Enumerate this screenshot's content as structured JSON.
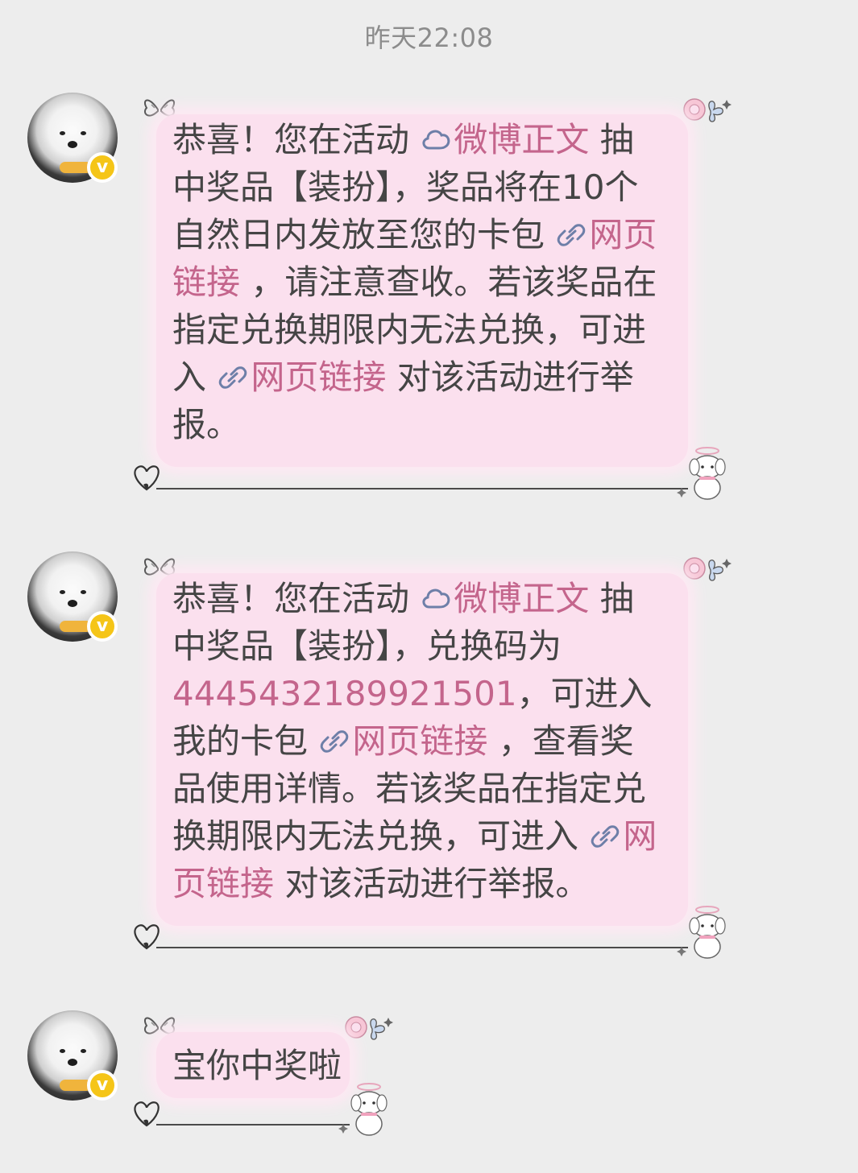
{
  "timestamp": "昨天22:08",
  "messages": [
    {
      "lines": [
        [
          {
            "t": "恭喜！您在活动 "
          },
          {
            "icon": "cloud"
          },
          {
            "t": "微博正文",
            "link": true
          },
          {
            "t": " 抽"
          }
        ],
        [
          {
            "t": "中奖品【装扮】，奖品将在10个"
          }
        ],
        [
          {
            "t": "自然日内发放至您的卡包 "
          },
          {
            "icon": "link"
          },
          {
            "t": "网页",
            "link": true
          }
        ],
        [
          {
            "t": "链接",
            "link": true
          },
          {
            "t": " ，请注意查收。若该奖品在"
          }
        ],
        [
          {
            "t": "指定兑换期限内无法兑换，可进"
          }
        ],
        [
          {
            "t": "入 "
          },
          {
            "icon": "link"
          },
          {
            "t": "网页链接",
            "link": true
          },
          {
            "t": " 对该活动进行举"
          }
        ],
        [
          {
            "t": "报。"
          }
        ]
      ]
    },
    {
      "lines": [
        [
          {
            "t": "恭喜！您在活动 "
          },
          {
            "icon": "cloud"
          },
          {
            "t": "微博正文",
            "link": true
          },
          {
            "t": " 抽"
          }
        ],
        [
          {
            "t": "中奖品【装扮】，兑换码为"
          }
        ],
        [
          {
            "t": "4445432189921501",
            "link": true
          },
          {
            "t": "，可进入"
          }
        ],
        [
          {
            "t": "我的卡包 "
          },
          {
            "icon": "link"
          },
          {
            "t": "网页链接",
            "link": true
          },
          {
            "t": " ，查看奖"
          }
        ],
        [
          {
            "t": "品使用详情。若该奖品在指定兑"
          }
        ],
        [
          {
            "t": "换期限内无法兑换，可进入 "
          },
          {
            "icon": "link"
          },
          {
            "t": "网",
            "link": true
          }
        ],
        [
          {
            "t": "页链接",
            "link": true
          },
          {
            "t": " 对该活动进行举报。"
          }
        ]
      ]
    },
    {
      "lines": [
        [
          {
            "t": "宝你中奖啦"
          }
        ]
      ]
    }
  ],
  "colors": {
    "background": "#ededed",
    "bubble": "#fbe0ee",
    "link": "#c4658c",
    "text": "#454545",
    "badge": "#f5c518"
  },
  "icons": {
    "cloud": "cloud-icon",
    "link": "link-icon",
    "badge": "verified-v-icon"
  }
}
